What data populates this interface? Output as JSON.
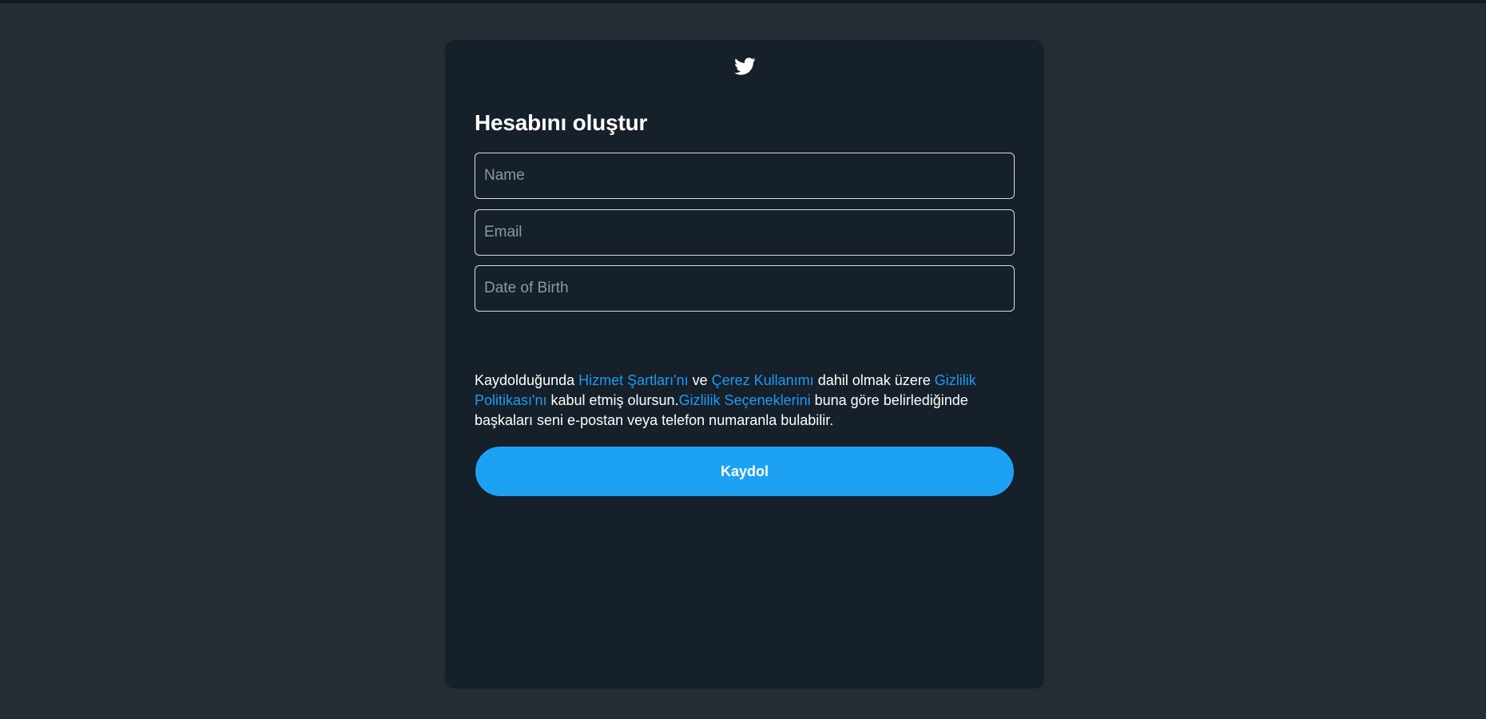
{
  "page": {
    "background": "#242c34",
    "card_background": "#15202b",
    "accent": "#1da1f2",
    "link_color": "#1d9bf0"
  },
  "logo": {
    "icon": "twitter-bird-icon"
  },
  "form": {
    "title": "Hesabını oluştur",
    "fields": {
      "name": {
        "placeholder": "Name",
        "value": ""
      },
      "email": {
        "placeholder": "Email",
        "value": ""
      },
      "dob": {
        "placeholder": "Date of Birth",
        "value": ""
      }
    }
  },
  "legal": {
    "t1": "Kaydolduğunda ",
    "link_terms": "Hizmet Şartları'nı",
    "t2": " ve ",
    "link_cookies": "Çerez Kullanımı",
    "t3": " dahil olmak üzere ",
    "link_privacy": "Gizlilik Politikası'nı",
    "t4": " kabul etmiş olursun.",
    "link_privacy_options": "Gizlilik Seçeneklerini",
    "t5": " buna göre belirlediğinde başkaları seni e-postan veya telefon numaranla bulabilir."
  },
  "signup": {
    "label": "Kaydol"
  }
}
